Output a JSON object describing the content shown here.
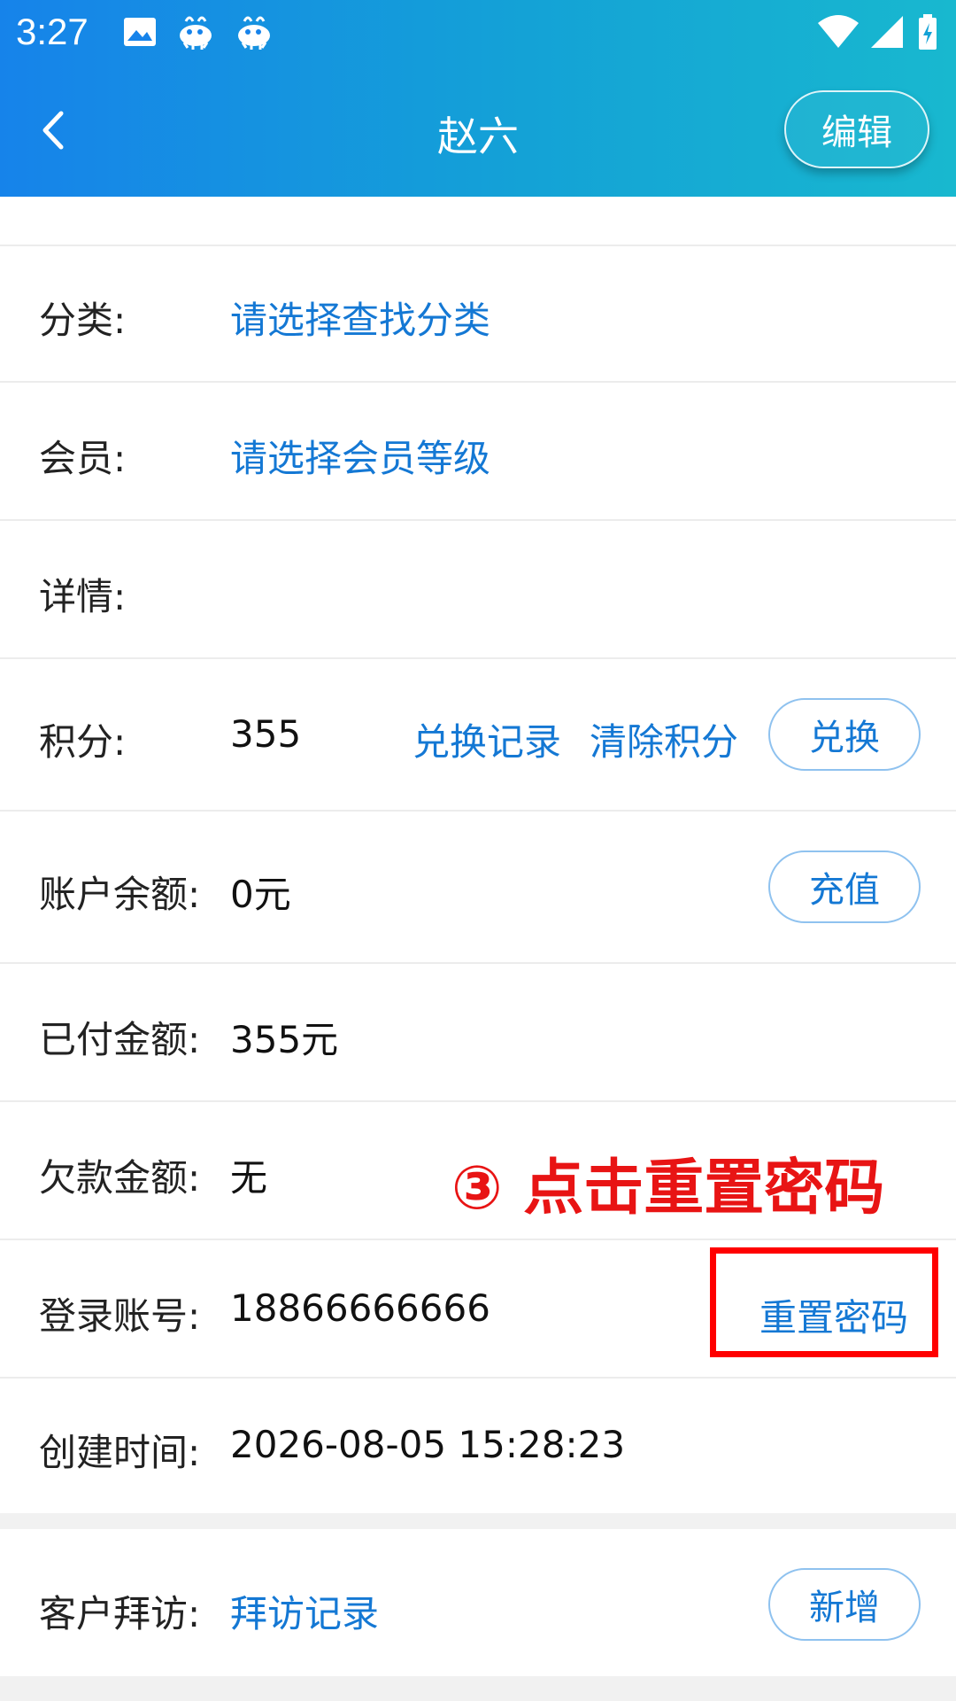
{
  "status_bar": {
    "time": "3:27",
    "icons_left": [
      "image-icon",
      "app-notification-icon",
      "app-notification-icon"
    ],
    "icons_right": [
      "wifi-icon",
      "cellular-signal-icon",
      "battery-charging-icon"
    ]
  },
  "header": {
    "title": "赵六",
    "edit_label": "编辑",
    "back_icon": "chevron-left-icon"
  },
  "rows": {
    "category": {
      "label": "分类:",
      "value": "请选择查找分类"
    },
    "member": {
      "label": "会员:",
      "value": "请选择会员等级"
    },
    "details": {
      "label": "详情:"
    },
    "points": {
      "label": "积分:",
      "value": "355",
      "exchange_record": "兑换记录",
      "clear_points": "清除积分",
      "exchange_button": "兑换"
    },
    "balance": {
      "label": "账户余额:",
      "value": "0元",
      "recharge_button": "充值"
    },
    "paid": {
      "label": "已付金额:",
      "value": "355元"
    },
    "owed": {
      "label": "欠款金额:",
      "value": "无"
    },
    "login": {
      "label": "登录账号:",
      "value": "18866666666",
      "reset_password": "重置密码"
    },
    "created": {
      "label": "创建时间:",
      "value": "2026-08-05 15:28:23"
    },
    "visit": {
      "label": "客户拜访:",
      "value": "拜访记录",
      "add_button": "新增"
    }
  },
  "annotation": {
    "text": "③ 点击重置密码",
    "color": "#e81414"
  },
  "colors": {
    "header_gradient_start": "#1683ea",
    "header_gradient_end": "#18b8cf",
    "link": "#1478d4",
    "annotation_red": "#ff0000"
  }
}
